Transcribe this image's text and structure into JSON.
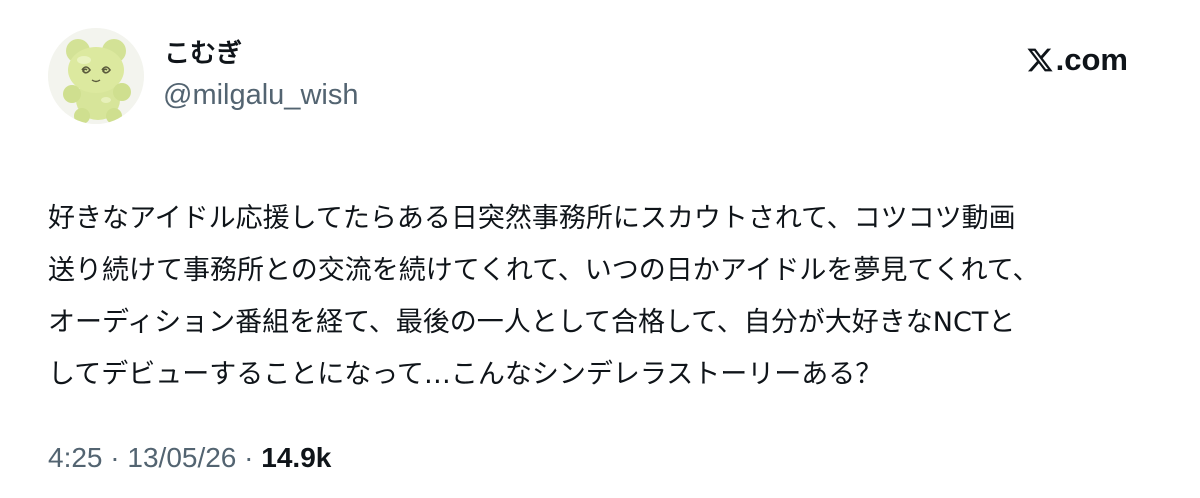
{
  "author": {
    "display_name": "こむぎ",
    "handle": "@milgalu_wish",
    "avatar_icon": "gummy-bear-avatar-icon"
  },
  "brand": {
    "logo_icon": "x-logo-icon",
    "text": ".com"
  },
  "post": {
    "lines": [
      "好きなアイドル応援してたらある日突然事務所にスカウトされて、コツコツ動画",
      "送り続けて事務所との交流を続けてくれて、いつの日かアイドルを夢見てくれて、",
      "オーディション番組を経て、最後の一人として合格して、自分が大好きなNCTと",
      "してデビューすることになって…こんなシンデレラストーリーある？"
    ]
  },
  "meta": {
    "time": "4:25",
    "separator": " · ",
    "date": "13/05/26",
    "views": "14.9k"
  },
  "colors": {
    "text_primary": "#0f1419",
    "text_secondary": "#536471",
    "background": "#ffffff",
    "avatar_gummy": "#d7e59a"
  }
}
